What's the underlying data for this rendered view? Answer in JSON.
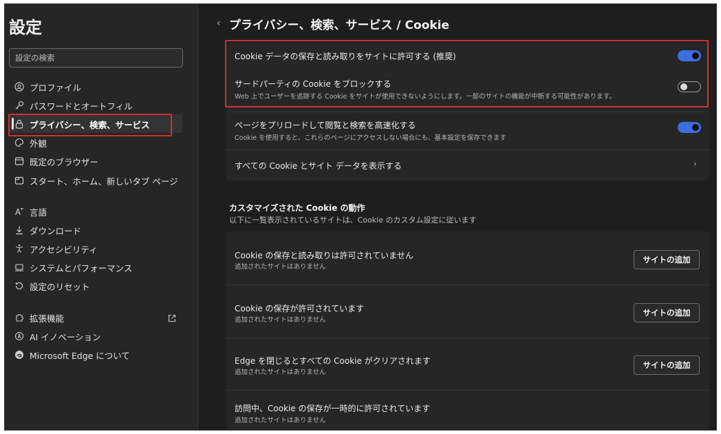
{
  "sidebar": {
    "title": "設定",
    "search_placeholder": "設定の検索",
    "items": [
      {
        "label": "プロファイル",
        "icon": "profile-icon"
      },
      {
        "label": "パスワードとオートフィル",
        "icon": "key-icon"
      },
      {
        "label": "プライバシー、検索、サービス",
        "icon": "lock-icon",
        "active": true
      },
      {
        "label": "外観",
        "icon": "appearance-icon"
      },
      {
        "label": "既定のブラウザー",
        "icon": "browser-icon"
      },
      {
        "label": "スタート、ホーム、新しいタブ ページ",
        "icon": "home-tab-icon"
      },
      {
        "label": "言語",
        "icon": "language-icon"
      },
      {
        "label": "ダウンロード",
        "icon": "download-icon"
      },
      {
        "label": "アクセシビリティ",
        "icon": "accessibility-icon"
      },
      {
        "label": "システムとパフォーマンス",
        "icon": "system-icon"
      },
      {
        "label": "設定のリセット",
        "icon": "reset-icon"
      },
      {
        "label": "拡張機能",
        "icon": "extensions-icon"
      },
      {
        "label": "AI イノベーション",
        "icon": "ai-icon"
      },
      {
        "label": "Microsoft Edge について",
        "icon": "edge-icon"
      }
    ]
  },
  "main": {
    "title": "プライバシー、検索、サービス / Cookie",
    "card1": {
      "row1": {
        "title": "Cookie データの保存と読み取りをサイトに許可する (推奨)",
        "toggle": "on"
      },
      "row2": {
        "title": "サードパーティの Cookie をブロックする",
        "subtitle": "Web 上でユーザーを追跡する Cookie をサイトが使用できないようにします。一部のサイトの機能が中断する可能性があります。",
        "toggle": "off"
      },
      "row3": {
        "title": "ページをプリロードして閲覧と検索を高速化する",
        "subtitle": "Cookie を使用すると、これらのページにアクセスしない場合にも、基本設定を保存できます",
        "toggle": "on"
      },
      "row4": {
        "title": "すべての Cookie とサイト データを表示する"
      }
    },
    "custom_section": {
      "title": "カスタマイズされた Cookie の動作",
      "description": "以下に一覧表示されているサイトは、Cookie のカスタム設定に従います",
      "rows": [
        {
          "title": "Cookie の保存と読み取りは許可されていません",
          "subtitle": "追加されたサイトはありません",
          "button": "サイトの追加"
        },
        {
          "title": "Cookie の保存が許可されています",
          "subtitle": "追加されたサイトはありません",
          "button": "サイトの追加"
        },
        {
          "title": "Edge を閉じるとすべての Cookie がクリアされます",
          "subtitle": "追加されたサイトはありません",
          "button": "サイトの追加"
        },
        {
          "title": "訪問中、Cookie の保存が一時的に許可されています",
          "subtitle": "追加されたサイトはありません"
        }
      ]
    }
  },
  "colors": {
    "accent": "#3b6fe0",
    "highlight": "#d32f2f"
  }
}
